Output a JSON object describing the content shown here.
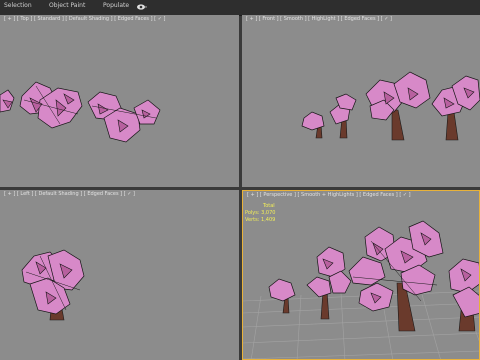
{
  "ribbon": {
    "tabs": [
      {
        "label": "Selection"
      },
      {
        "label": "Object Paint"
      },
      {
        "label": "Populate"
      }
    ],
    "eye_dropdown_icon": "eye-icon"
  },
  "viewports": {
    "top": {
      "label": "[ + ] [ Top ] [ Standard ] [ Default Shading ] [ Edged Faces ] [ ✓ ]"
    },
    "front": {
      "label": "[ + ] [ Front ] [ Smooth ] [ HighLight ] [ Edged Faces ] [ ✓ ]"
    },
    "left": {
      "label": "[ + ] [ Left ] [ Default Shading ] [ Edged Faces ] [ ✓ ]"
    },
    "perspective": {
      "label": "[ + ] [ Perspective ] [ Smooth + HighLights ] [ Edged Faces ] [ ✓ ]",
      "stats": {
        "total_label": "Total",
        "polys_label": "Polys:",
        "polys_value": "3,070",
        "verts_label": "Verts:",
        "verts_value": "1,409"
      }
    }
  },
  "colors": {
    "viewport_bg": "#8c8c8c",
    "active_border": "#e8b23a",
    "blossom": "#d789c8",
    "stats_text": "#f2ee59"
  }
}
